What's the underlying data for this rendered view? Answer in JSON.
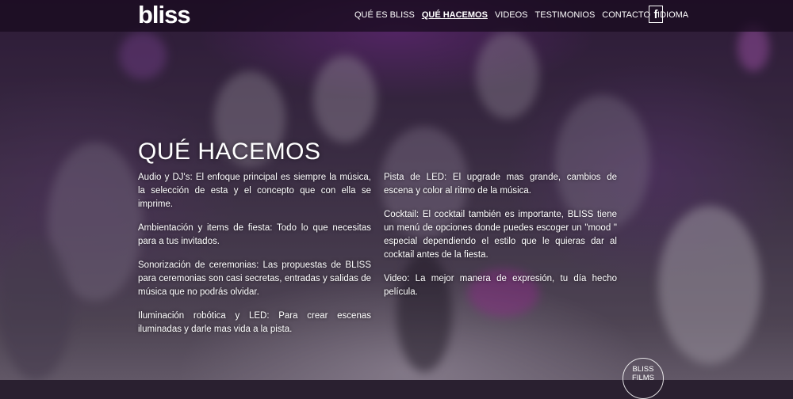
{
  "header": {
    "logo": "bliss",
    "nav": [
      {
        "label": "QUÉ ES BLISS",
        "active": false
      },
      {
        "label": "QUÉ HACEMOS",
        "active": true
      },
      {
        "label": "VIDEOS",
        "active": false
      },
      {
        "label": "TESTIMONIOS",
        "active": false
      },
      {
        "label": "CONTACTO",
        "active": false
      },
      {
        "label": "IDIOMA",
        "active": false
      }
    ],
    "facebook_glyph": "f",
    "facebook_icon": "facebook-icon"
  },
  "main": {
    "title": "QUÉ HACEMOS",
    "left_column": [
      "Audio y DJ's: El enfoque principal es siempre la música, la selección de esta y el concepto que con ella se imprime.",
      "Ambientación y items de fiesta: Todo lo que necesitas para a tus invitados.",
      "Sonorización de ceremonias: Las propuestas de BLISS para ceremonias son casi secretas, entradas y salidas de música que no podrás olvidar.",
      "Iluminación robótica y LED: Para crear escenas iluminadas y darle mas vida a la pista."
    ],
    "right_column": [
      "Pista de LED: El upgrade mas grande, cambios de escena y color al ritmo de la música.",
      "Cocktail: El cocktail también es importante, BLISS tiene un menú de opciones donde puedes escoger un \"mood \" especial dependiendo el estilo que le quieras dar al cocktail antes de la fiesta.",
      "Video: La mejor manera de expresión, tu día hecho película."
    ]
  },
  "badge": {
    "line1": "BLISS",
    "line2": "FILMS"
  }
}
